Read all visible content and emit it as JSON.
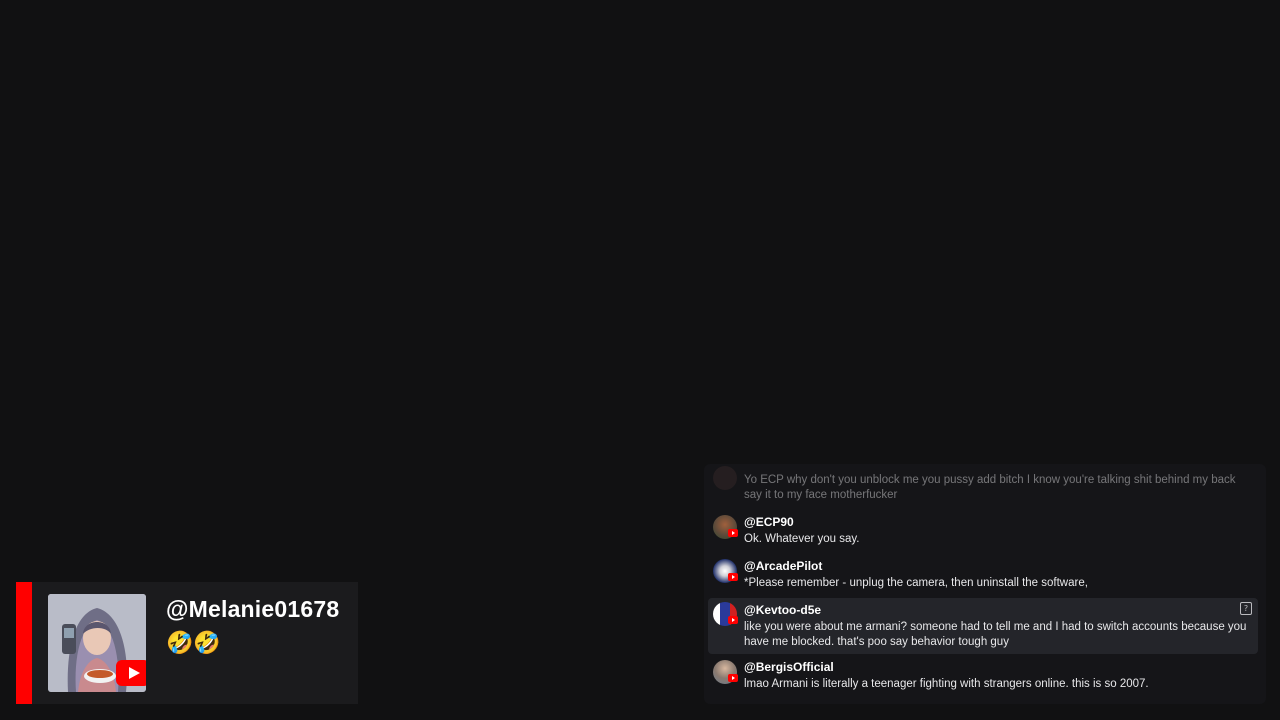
{
  "featured": {
    "handle": "@Melanie01678",
    "message": "🤣🤣",
    "accent_color": "#ff0000",
    "icons": [
      "avatar",
      "youtube-icon"
    ]
  },
  "chat": {
    "messages": [
      {
        "author": "",
        "text": "Yo ECP why don't you unblock me you pussy add bitch I know you're talking shit behind my back say it to my face motherfucker",
        "faded": true
      },
      {
        "author": "@ECP90",
        "text": "Ok. Whatever you say."
      },
      {
        "author": "@ArcadePilot",
        "text": "*Please remember - unplug the camera, then uninstall the software,"
      },
      {
        "author": "@Kevtoo-d5e",
        "text": "like you were about me armani? someone had to tell me and I had to switch accounts because you have me blocked. that's poo say behavior tough guy",
        "highlighted": true,
        "icon": "flag-icon"
      },
      {
        "author": "@BergisOfficial",
        "text": "lmao Armani is literally a teenager fighting with strangers online. this is so 2007."
      }
    ]
  }
}
